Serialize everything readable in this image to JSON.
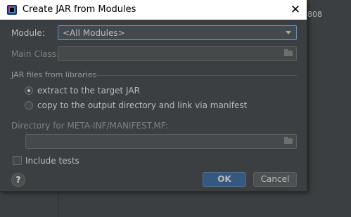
{
  "background": {
    "partial_text": "808"
  },
  "dialog": {
    "title": "Create JAR from Modules",
    "close_glyph": "✕",
    "module": {
      "label": "Module:",
      "value": "<All Modules>"
    },
    "main_class": {
      "label": "Main Class:",
      "value": ""
    },
    "libraries_group": {
      "title": "JAR files from libraries",
      "options": [
        {
          "label": "extract to the target JAR",
          "selected": true
        },
        {
          "label": "copy to the output directory and link via manifest",
          "selected": false
        }
      ]
    },
    "manifest_dir": {
      "label": "Directory for META-INF/MANIFEST.MF:",
      "value": ""
    },
    "include_tests": {
      "label": "Include tests",
      "checked": false
    },
    "help_glyph": "?",
    "ok_label": "OK",
    "cancel_label": "Cancel"
  },
  "colors": {
    "accent": "#365880",
    "focus_border": "#5e93cf",
    "bg": "#3c3f41"
  }
}
